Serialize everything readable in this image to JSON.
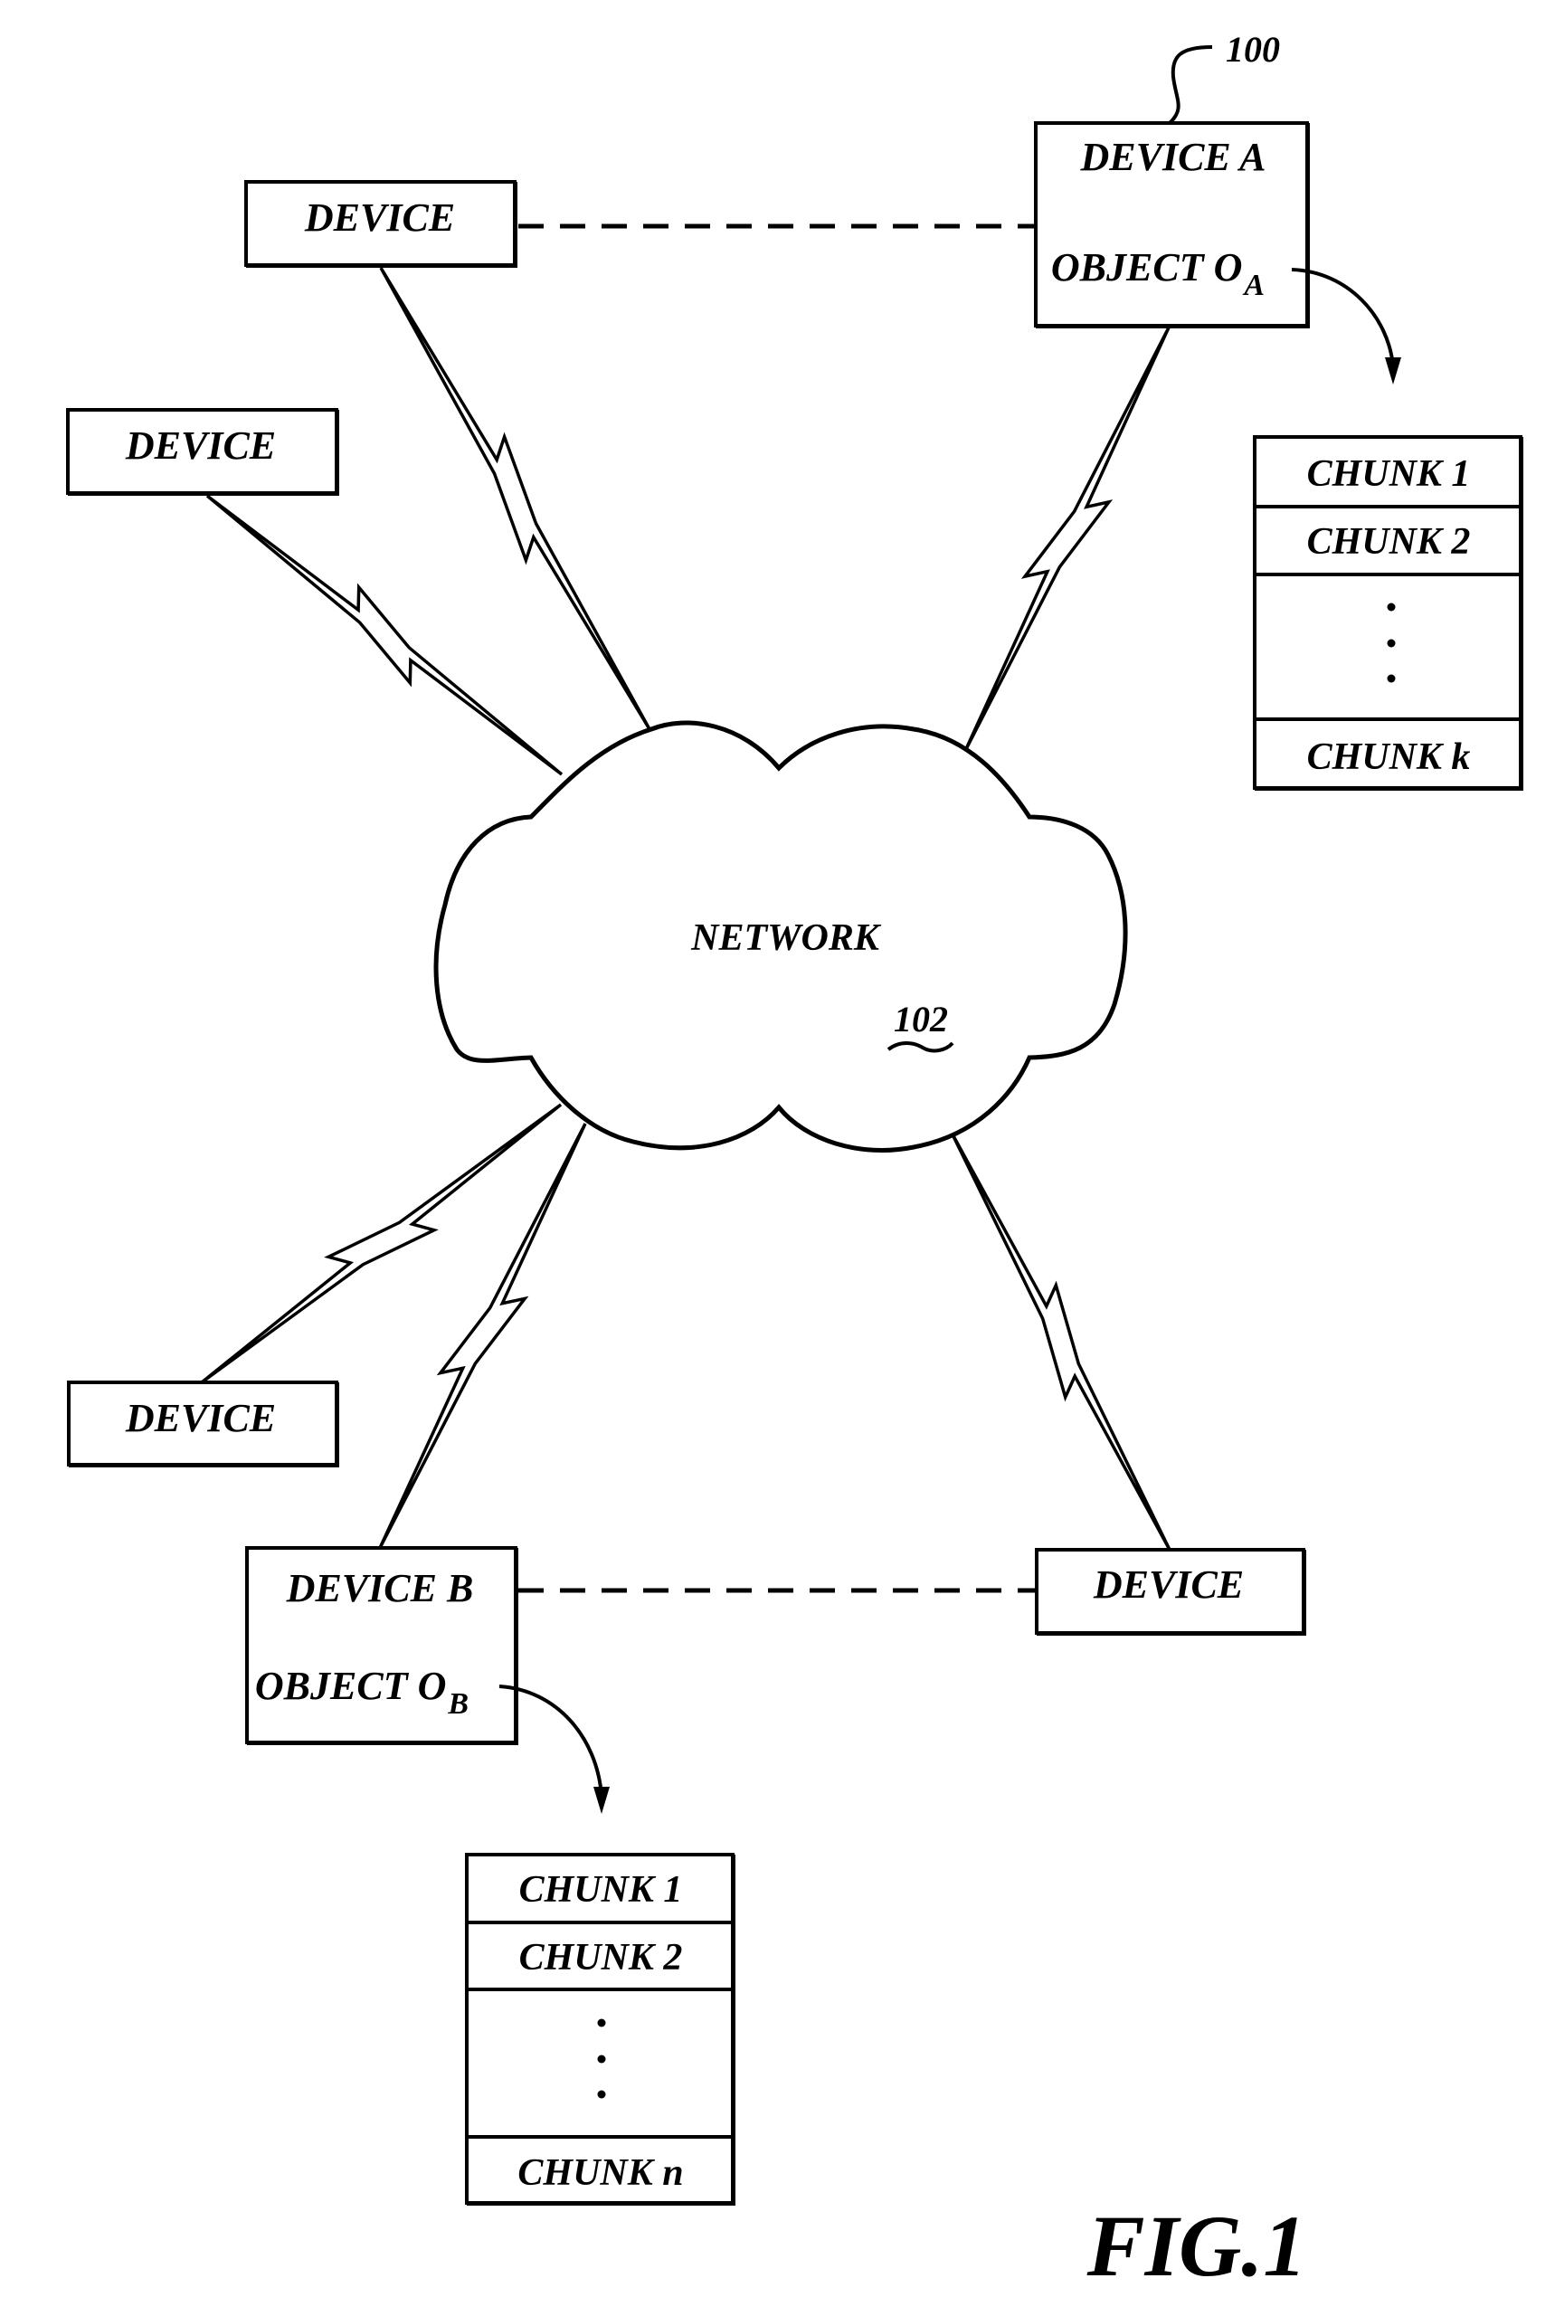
{
  "figure": {
    "caption": "FIG.1",
    "system_ref": "100"
  },
  "network": {
    "label": "NETWORK",
    "ref": "102"
  },
  "devices": {
    "upper_left": "DEVICE",
    "left": "DEVICE",
    "lower_left": "DEVICE",
    "lower_right": "DEVICE",
    "device_a": {
      "name": "DEVICE A",
      "object_label": "OBJECT O",
      "object_sub": "A"
    },
    "device_b": {
      "name": "DEVICE B",
      "object_label": "OBJECT O",
      "object_sub": "B"
    }
  },
  "chunks_a": {
    "items": [
      "CHUNK 1",
      "CHUNK 2",
      "CHUNK k"
    ],
    "ellipsis": "⋮"
  },
  "chunks_b": {
    "items": [
      "CHUNK 1",
      "CHUNK 2",
      "CHUNK n"
    ],
    "ellipsis": "⋮"
  },
  "links": {
    "wired": [
      {
        "from": "upper_left",
        "to": "device_a",
        "style": "dashed"
      },
      {
        "from": "device_b",
        "to": "lower_right",
        "style": "dashed"
      }
    ],
    "wireless": [
      {
        "from": "upper_left",
        "to": "network",
        "style": "lightning"
      },
      {
        "from": "left",
        "to": "network",
        "style": "lightning"
      },
      {
        "from": "device_a",
        "to": "network",
        "style": "lightning"
      },
      {
        "from": "lower_left",
        "to": "network",
        "style": "lightning"
      },
      {
        "from": "device_b",
        "to": "network",
        "style": "lightning"
      },
      {
        "from": "lower_right",
        "to": "network",
        "style": "lightning"
      }
    ]
  }
}
